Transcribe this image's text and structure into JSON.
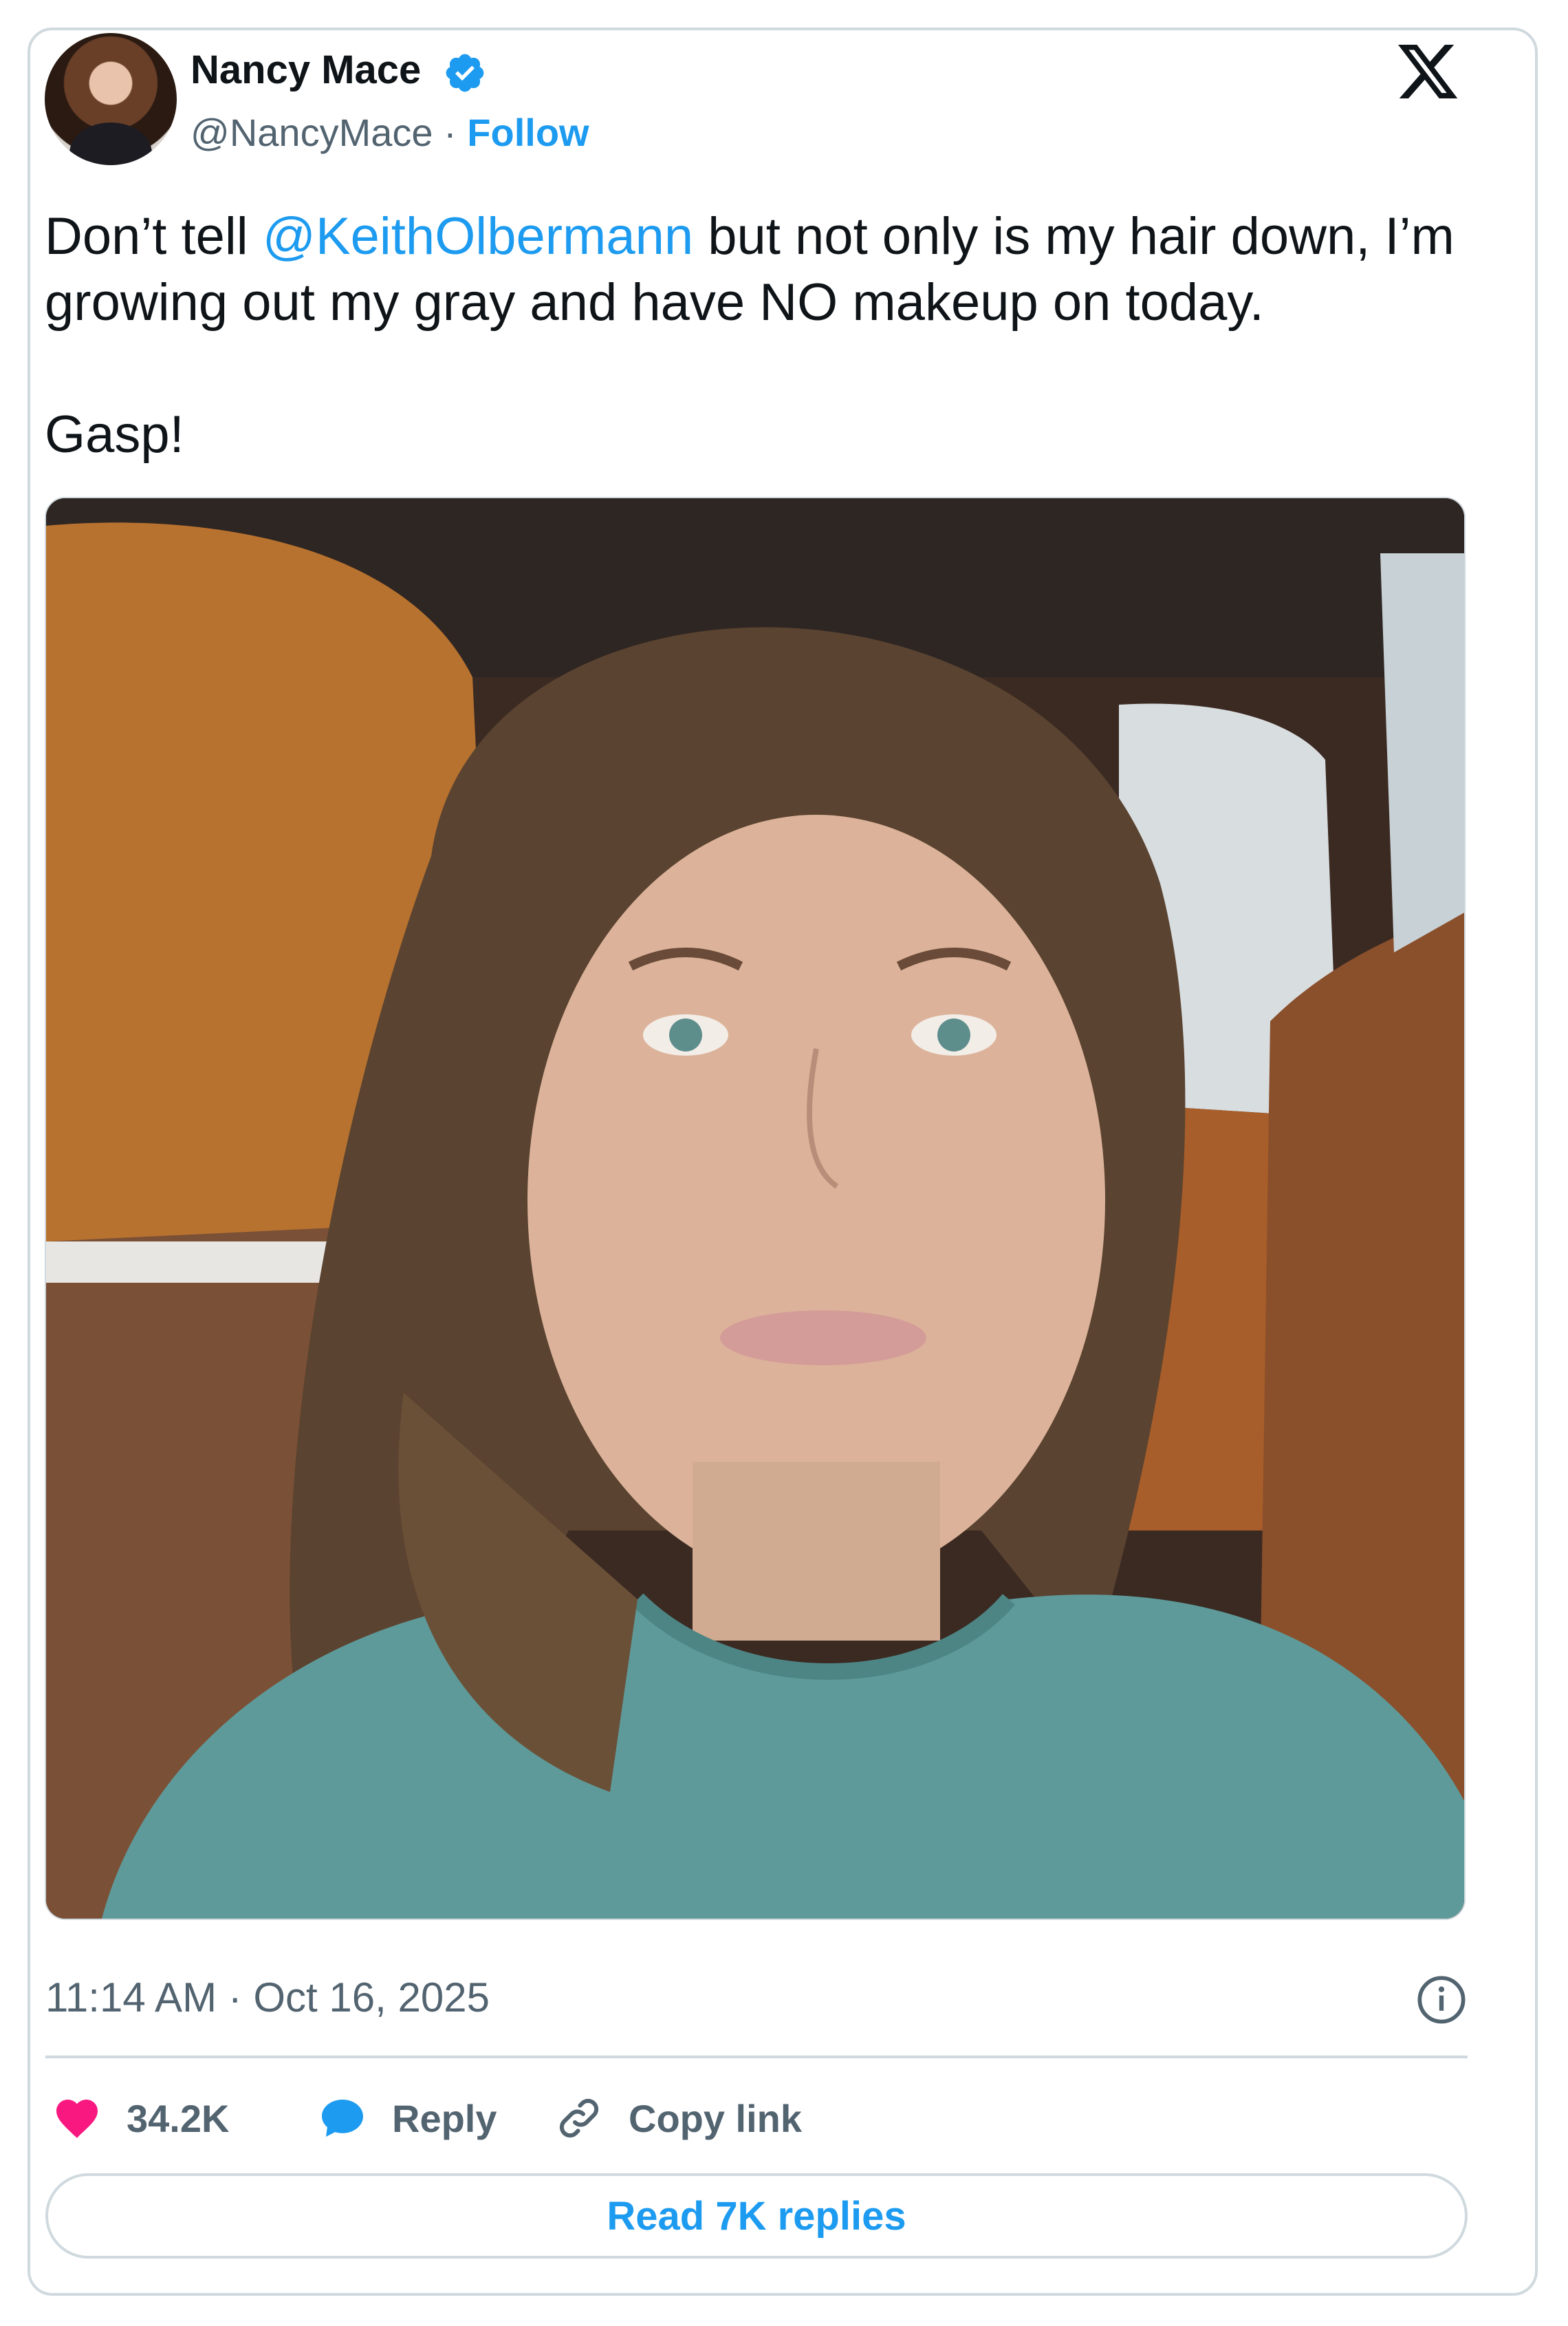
{
  "author": {
    "name": "Nancy Mace",
    "handle": "@NancyMace",
    "separator": "·",
    "follow_label": "Follow",
    "verified_icon": "verified-badge-icon",
    "verified_color": "#1d9bf0"
  },
  "platform_icon": "x-logo-icon",
  "tweet": {
    "text_before": "Don’t tell ",
    "mention": "@KeithOlbermann",
    "text_after": " but not only is my hair down, I’m growing out my gray and have NO makeup on today.",
    "text_second": "Gasp!",
    "timestamp": "11:14 AM · Oct 16, 2025"
  },
  "actions": {
    "likes": "34.2K",
    "reply_label": "Reply",
    "copy_link_label": "Copy link",
    "read_replies_label": "Read 7K replies"
  },
  "colors": {
    "accent": "#1d9bf0",
    "like": "#f91880",
    "secondary_text": "#536471",
    "border": "#cfd9de"
  }
}
